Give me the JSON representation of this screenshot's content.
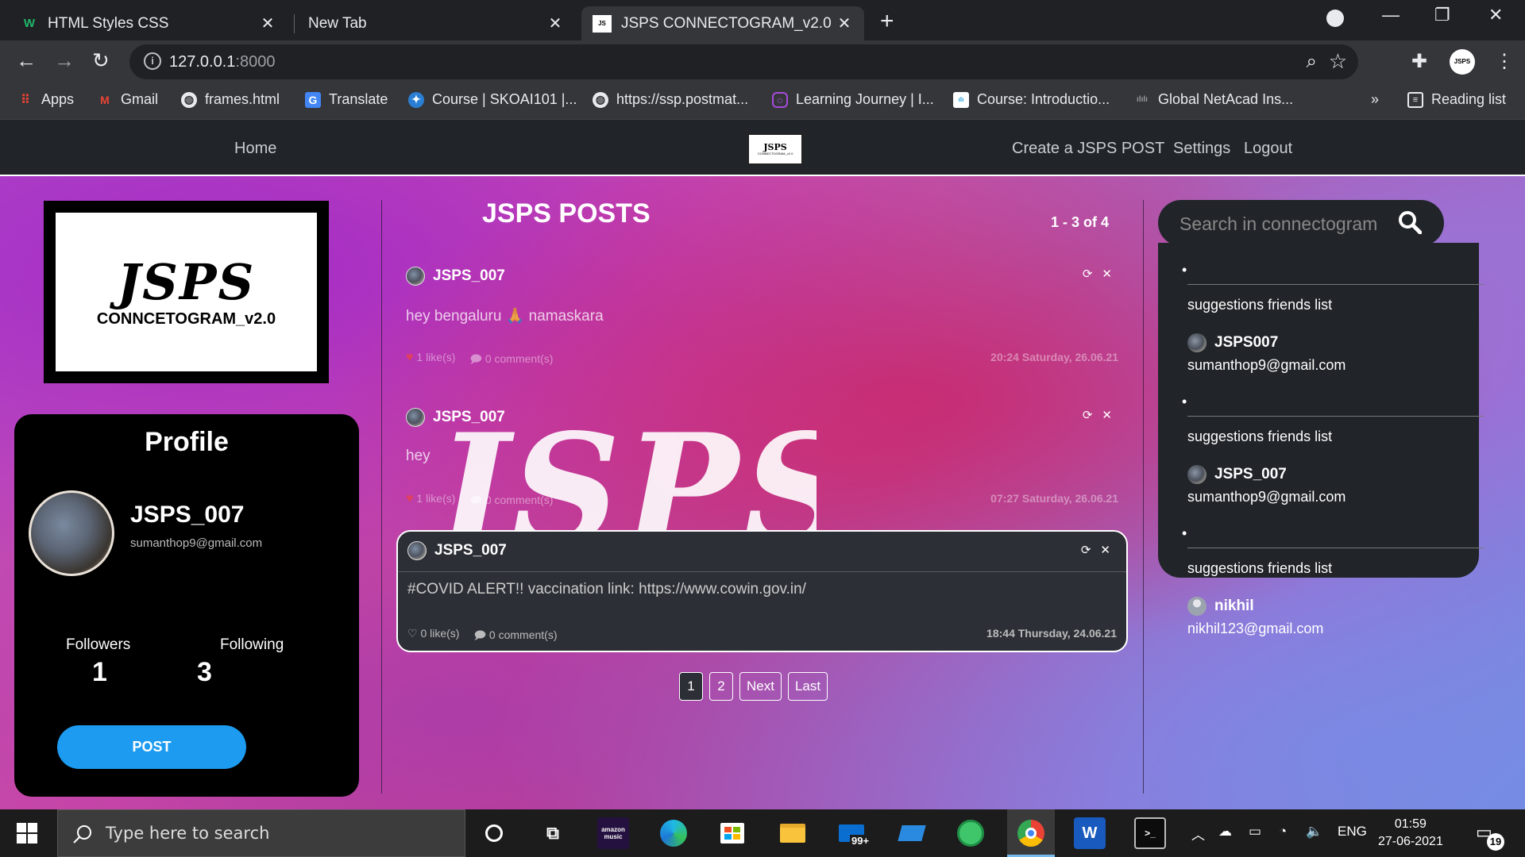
{
  "browser": {
    "tabs": [
      {
        "title": "HTML Styles CSS",
        "favicon": "W"
      },
      {
        "title": "New Tab",
        "favicon": ""
      },
      {
        "title": "JSPS CONNECTOGRAM_v2.0",
        "favicon": "JS"
      }
    ],
    "url_host": "127.0.0.1",
    "url_port": ":8000",
    "bookmarks": [
      {
        "label": "Apps",
        "icon": "apps-grid-icon"
      },
      {
        "label": "Gmail",
        "icon": "gmail-icon"
      },
      {
        "label": "frames.html",
        "icon": "globe-icon"
      },
      {
        "label": "Translate",
        "icon": "translate-icon"
      },
      {
        "label": "Course | SKOAI101 |...",
        "icon": "course-icon"
      },
      {
        "label": "https://ssp.postmat...",
        "icon": "globe-icon"
      },
      {
        "label": "Learning Journey | I...",
        "icon": "learning-icon"
      },
      {
        "label": "Course: Introductio...",
        "icon": "cisco-icon"
      },
      {
        "label": "Global NetAcad Ins...",
        "icon": "cisco-icon"
      }
    ],
    "more_bookmarks": "»",
    "reading_list": "Reading list"
  },
  "sitenav": {
    "home": "Home",
    "create": "Create a JSPS POST",
    "settings": "Settings",
    "logout": "Logout",
    "logo_text": "JSPS",
    "logo_sub": "CONNECTOGRAM_v2.0"
  },
  "brand": {
    "big": "JSPS",
    "small": "CONNCETOGRAM_v2.0"
  },
  "profile": {
    "title": "Profile",
    "name": "JSPS_007",
    "email": "sumanthop9@gmail.com",
    "followers_label": "Followers",
    "followers": "1",
    "following_label": "Following",
    "following": "3",
    "post_button": "POST"
  },
  "feed": {
    "title": "JSPS POSTS",
    "count": "1 - 3 of 4",
    "posts": [
      {
        "author": "JSPS_007",
        "body": "hey bengaluru 🙏 namaskara",
        "likes": "1 like(s)",
        "comments": "0 comment(s)",
        "stamp": "20:24 Saturday, 26.06.21"
      },
      {
        "author": "JSPS_007",
        "body": "hey",
        "likes": "1 like(s)",
        "comments": "0 comment(s)",
        "stamp": "07:27 Saturday, 26.06.21"
      },
      {
        "author": "JSPS_007",
        "body": "#COVID ALERT!! vaccination link: https://www.cowin.gov.in/",
        "likes": "0 like(s)",
        "comments": "0 comment(s)",
        "stamp": "18:44 Thursday, 24.06.21"
      }
    ],
    "watermark": "JSPS",
    "pager": {
      "p1": "1",
      "p2": "2",
      "next": "Next",
      "last": "Last"
    }
  },
  "sidebar": {
    "search_placeholder": "Search in connectogram",
    "suggestions": [
      {
        "label": "suggestions friends list",
        "name": "JSPS007",
        "email": "sumanthop9@gmail.com"
      },
      {
        "label": "suggestions friends list",
        "name": "JSPS_007",
        "email": "sumanthop9@gmail.com"
      },
      {
        "label": "suggestions friends list",
        "name": "nikhil",
        "email": "nikhil123@gmail.com"
      }
    ]
  },
  "taskbar": {
    "search_placeholder": "Type here to search",
    "lang": "ENG",
    "time": "01:59",
    "date": "27-06-2021",
    "notifications": "19",
    "mail_badge": "99+",
    "music_label": "amazon music"
  },
  "colors": {
    "accent": "#1d9bf0",
    "navbar": "#212529",
    "card": "#2c3036"
  }
}
